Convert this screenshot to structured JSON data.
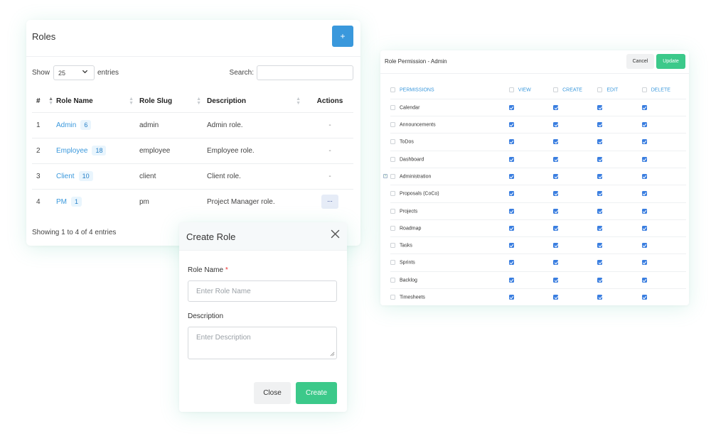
{
  "roles": {
    "title": "Roles",
    "add_label": "+",
    "show_label": "Show",
    "page_size": "25",
    "entries_label": "entries",
    "search_label": "Search:",
    "search_value": "",
    "columns": [
      "#",
      "Role Name",
      "Role Slug",
      "Description",
      "Actions"
    ],
    "rows": [
      {
        "num": "1",
        "name": "Admin",
        "count": "6",
        "slug": "admin",
        "description": "Admin role.",
        "action": "-"
      },
      {
        "num": "2",
        "name": "Employee",
        "count": "18",
        "slug": "employee",
        "description": "Employee role.",
        "action": "-"
      },
      {
        "num": "3",
        "name": "Client",
        "count": "10",
        "slug": "client",
        "description": "Client role.",
        "action": "-"
      },
      {
        "num": "4",
        "name": "PM",
        "count": "1",
        "slug": "pm",
        "description": "Project Manager role.",
        "action": "..."
      }
    ],
    "footer": "Showing 1 to 4 of 4 entries"
  },
  "create_role": {
    "title": "Create Role",
    "close_icon": "×",
    "role_name_label": "Role Name",
    "required_mark": "*",
    "role_name_placeholder": "Enter Role Name",
    "description_label": "Description",
    "description_placeholder": "Enter Description",
    "close_label": "Close",
    "create_label": "Create"
  },
  "permissions": {
    "title": "Role Permission - Admin",
    "cancel_label": "Cancel",
    "update_label": "Update",
    "headers": [
      "PERMISSIONS",
      "VIEW",
      "CREATE",
      "EDIT",
      "DELETE"
    ],
    "rows": [
      {
        "name": "Calendar",
        "expandable": false
      },
      {
        "name": "Announcements",
        "expandable": false
      },
      {
        "name": "ToDos",
        "expandable": false
      },
      {
        "name": "Dashboard",
        "expandable": false
      },
      {
        "name": "Administration",
        "expandable": true
      },
      {
        "name": "Proposals (CoCo)",
        "expandable": false
      },
      {
        "name": "Projects",
        "expandable": false
      },
      {
        "name": "Roadmap",
        "expandable": false
      },
      {
        "name": "Tasks",
        "expandable": false
      },
      {
        "name": "Sprints",
        "expandable": false
      },
      {
        "name": "Backlog",
        "expandable": false
      },
      {
        "name": "Timesheets",
        "expandable": false
      }
    ]
  },
  "colors": {
    "primary": "#3a98dc",
    "success": "#3cc98a",
    "checkbox": "#3a7ee0"
  }
}
